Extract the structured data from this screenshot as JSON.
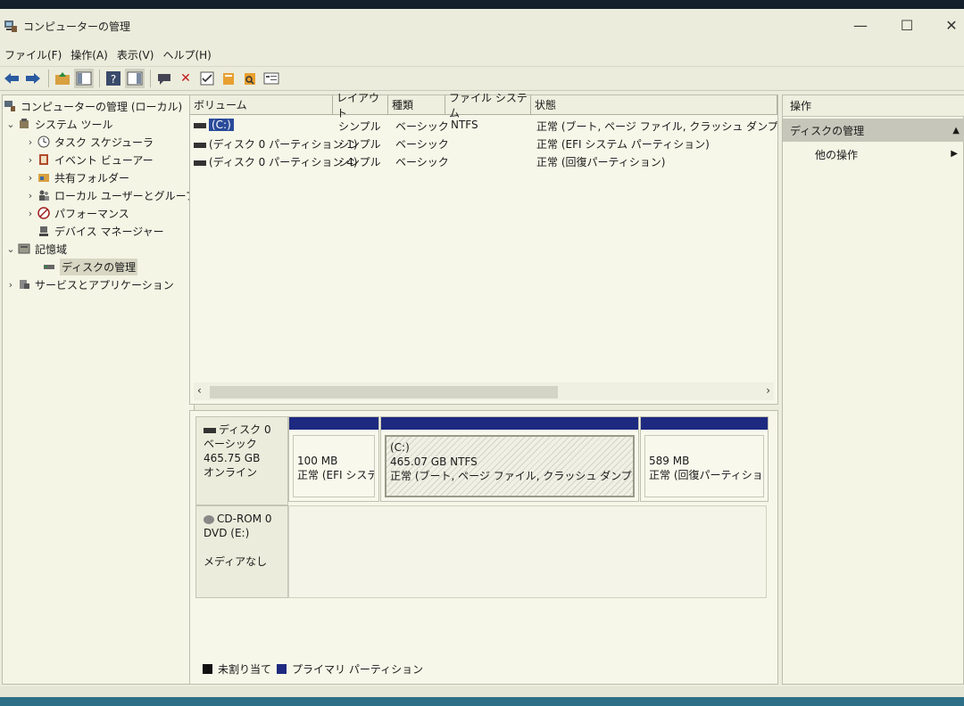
{
  "window": {
    "title": "コンピューターの管理",
    "controls": {
      "minimize": "—",
      "maximize": "☐",
      "close": "✕"
    }
  },
  "menu": [
    "ファイル(F)",
    "操作(A)",
    "表示(V)",
    "ヘルプ(H)"
  ],
  "toolbar": [
    "back-arrow-icon",
    "forward-arrow-icon",
    "folder-up-icon",
    "show-hide-tree-icon",
    "help-icon",
    "console-icon",
    "connect-icon",
    "delete-icon",
    "check-icon",
    "new-icon",
    "search-icon",
    "properties-icon"
  ],
  "tree": {
    "root": "コンピューターの管理 (ローカル)",
    "system_tools": "システム ツール",
    "task_scheduler": "タスク スケジューラ",
    "event_viewer": "イベント ビューアー",
    "shared_folders": "共有フォルダー",
    "local_users": "ローカル ユーザーとグループ",
    "performance": "パフォーマンス",
    "device_manager": "デバイス マネージャー",
    "storage": "記憶域",
    "disk_management": "ディスクの管理",
    "services": "サービスとアプリケーション"
  },
  "volumes": {
    "headers": [
      "ボリューム",
      "レイアウト",
      "種類",
      "ファイル システム",
      "状態"
    ],
    "rows": [
      {
        "volume": "(C:)",
        "layout": "シンプル",
        "type": "ベーシック",
        "fs": "NTFS",
        "status": "正常 (ブート, ページ ファイル, クラッシュ ダンプ, ベーシ"
      },
      {
        "volume": "(ディスク 0 パーティション 1)",
        "layout": "シンプル",
        "type": "ベーシック",
        "fs": "",
        "status": "正常 (EFI システム パーティション)"
      },
      {
        "volume": "(ディスク 0 パーティション 4)",
        "layout": "シンプル",
        "type": "ベーシック",
        "fs": "",
        "status": "正常 (回復パーティション)"
      }
    ]
  },
  "disk0": {
    "name": "ディスク 0",
    "type": "ベーシック",
    "size": "465.75 GB",
    "state": "オンライン",
    "partitions": [
      {
        "line1": "",
        "line2": "100 MB",
        "line3": "正常 (EFI システ"
      },
      {
        "line1": "(C:)",
        "line2": "465.07 GB NTFS",
        "line3": "正常 (ブート, ページ ファイル, クラッシュ ダンプ, ベーシッ"
      },
      {
        "line1": "",
        "line2": "589 MB",
        "line3": "正常 (回復パーティション)"
      }
    ]
  },
  "cdrom": {
    "name": "CD-ROM 0",
    "drive": "DVD (E:)",
    "state": "メディアなし"
  },
  "legend": {
    "unallocated": "未割り当て",
    "unallocated_color": "#111111",
    "primary": "プライマリ パーティション",
    "primary_color": "#1e2a80"
  },
  "actions": {
    "header": "操作",
    "group": "ディスクの管理",
    "more": "他の操作"
  }
}
